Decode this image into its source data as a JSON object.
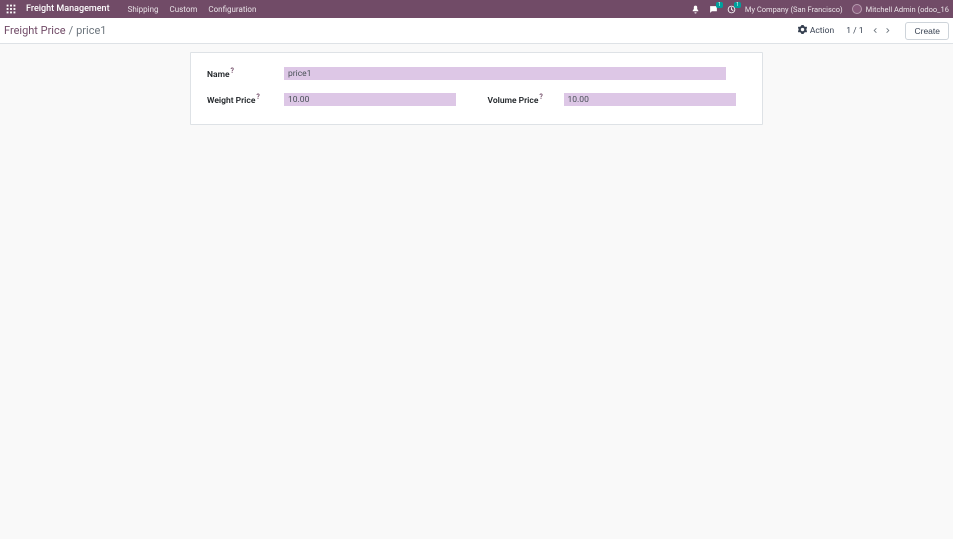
{
  "navbar": {
    "app_title": "Freight Management",
    "menu": [
      "Shipping",
      "Custom",
      "Configuration"
    ],
    "company": "My Company (San Francisco)",
    "user": "Mitchell Admin (odoo_16",
    "chat_badge": "1",
    "activity_badge": "1"
  },
  "control_panel": {
    "breadcrumb_link": "Freight Price",
    "breadcrumb_current": "price1",
    "action_label": "Action",
    "pager_text": "1 / 1",
    "create_label": "Create"
  },
  "form": {
    "name_label": "Name",
    "name_value": "price1",
    "weight_label": "Weight Price",
    "weight_value": "10.00",
    "volume_label": "Volume Price",
    "volume_value": "10.00"
  }
}
